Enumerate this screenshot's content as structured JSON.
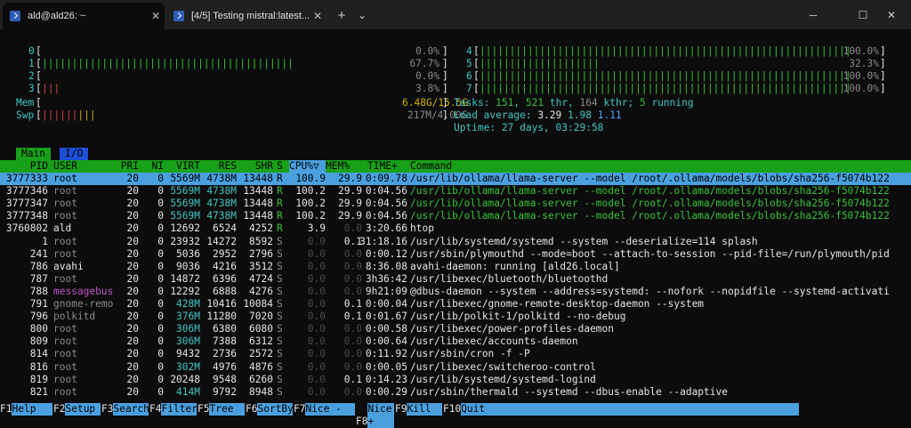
{
  "tabs": [
    {
      "label": "ald@ald26: ~"
    },
    {
      "label": "[4/5] Testing mistral:latest..."
    }
  ],
  "window": {
    "new_tab": "+",
    "dropdown": "⌄",
    "minimize": "─",
    "maximize": "☐",
    "close": "✕"
  },
  "cpu_meters": [
    {
      "label": "0",
      "value": "0.0%",
      "fill": 0.0
    },
    {
      "label": "1",
      "value": "67.7%",
      "fill": 0.677
    },
    {
      "label": "2",
      "value": "0.0%",
      "fill": 0.0
    },
    {
      "label": "3",
      "value": "3.8%",
      "fill": 0.038
    },
    {
      "label": "4",
      "value": "100.0%",
      "fill": 1.0
    },
    {
      "label": "5",
      "value": "32.3%",
      "fill": 0.323
    },
    {
      "label": "6",
      "value": "100.0%",
      "fill": 1.0
    },
    {
      "label": "7",
      "value": "100.0%",
      "fill": 1.0
    }
  ],
  "mem": {
    "label": "Mem",
    "value": "6.48G/15.5G"
  },
  "swp": {
    "label": "Swp",
    "value": "217M/4.00G"
  },
  "tasks": {
    "label": "Tasks:",
    "tasks": "151",
    "thr": "521",
    "thr_label": "thr,",
    "kthr": "164",
    "kthr_label": "kthr;",
    "running": "5",
    "running_label": "running"
  },
  "load": {
    "label": "Load average:",
    "v1": "3.29",
    "v2": "1.98",
    "v3": "1.11"
  },
  "uptime": {
    "label": "Uptime:",
    "value": "27 days, 03:29:58"
  },
  "screen_tabs": [
    "Main",
    "I/O"
  ],
  "columns": [
    "PID",
    "USER",
    "PRI",
    "NI",
    "VIRT",
    "RES",
    "SHR",
    "S",
    "CPU%▽",
    "MEM%",
    "TIME+",
    "Command"
  ],
  "processes": [
    {
      "pid": "3777333",
      "user": "root",
      "pri": "20",
      "ni": "0",
      "virt": "5569M",
      "res": "4738M",
      "shr": "13448",
      "s": "R",
      "cpu": "100.9",
      "mem": "29.9",
      "time": "0:09.78",
      "cmd": "/usr/lib/ollama/llama-server --model /root/.ollama/models/blobs/sha256-f5074b122"
    },
    {
      "pid": "3777346",
      "user": "root",
      "pri": "20",
      "ni": "0",
      "virt": "5569M",
      "res": "4738M",
      "shr": "13448",
      "s": "R",
      "cpu": "100.2",
      "mem": "29.9",
      "time": "0:04.56",
      "cmd": "/usr/lib/ollama/llama-server --model /root/.ollama/models/blobs/sha256-f5074b122"
    },
    {
      "pid": "3777347",
      "user": "root",
      "pri": "20",
      "ni": "0",
      "virt": "5569M",
      "res": "4738M",
      "shr": "13448",
      "s": "R",
      "cpu": "100.2",
      "mem": "29.9",
      "time": "0:04.56",
      "cmd": "/usr/lib/ollama/llama-server --model /root/.ollama/models/blobs/sha256-f5074b122"
    },
    {
      "pid": "3777348",
      "user": "root",
      "pri": "20",
      "ni": "0",
      "virt": "5569M",
      "res": "4738M",
      "shr": "13448",
      "s": "R",
      "cpu": "100.2",
      "mem": "29.9",
      "time": "0:04.56",
      "cmd": "/usr/lib/ollama/llama-server --model /root/.ollama/models/blobs/sha256-f5074b122"
    },
    {
      "pid": "3760802",
      "user": "ald",
      "pri": "20",
      "ni": "0",
      "virt": "12692",
      "res": "6524",
      "shr": "4252",
      "s": "R",
      "cpu": "3.9",
      "mem": "0.0",
      "time": "3:20.66",
      "cmd": "htop"
    },
    {
      "pid": "1",
      "user": "root",
      "pri": "20",
      "ni": "0",
      "virt": "23932",
      "res": "14272",
      "shr": "8592",
      "s": "S",
      "cpu": "0.0",
      "mem": "0.1",
      "time": "31:18.16",
      "cmd": "/usr/lib/systemd/systemd --system --deserialize=114 splash"
    },
    {
      "pid": "241",
      "user": "root",
      "pri": "20",
      "ni": "0",
      "virt": "5036",
      "res": "2952",
      "shr": "2796",
      "s": "S",
      "cpu": "0.0",
      "mem": "0.0",
      "time": "0:00.12",
      "cmd": "/usr/sbin/plymouthd --mode=boot --attach-to-session --pid-file=/run/plymouth/pid"
    },
    {
      "pid": "786",
      "user": "avahi",
      "pri": "20",
      "ni": "0",
      "virt": "9036",
      "res": "4216",
      "shr": "3512",
      "s": "S",
      "cpu": "0.0",
      "mem": "0.0",
      "time": "8:36.08",
      "cmd": "avahi-daemon: running [ald26.local]"
    },
    {
      "pid": "787",
      "user": "root",
      "pri": "20",
      "ni": "0",
      "virt": "14872",
      "res": "6396",
      "shr": "4724",
      "s": "S",
      "cpu": "0.0",
      "mem": "0.0",
      "time": "3h36:42",
      "cmd": "/usr/libexec/bluetooth/bluetoothd"
    },
    {
      "pid": "788",
      "user": "messagebus",
      "pri": "20",
      "ni": "0",
      "virt": "12292",
      "res": "6888",
      "shr": "4276",
      "s": "S",
      "cpu": "0.0",
      "mem": "0.0",
      "time": "9h21:09",
      "cmd": "@dbus-daemon --system --address=systemd: --nofork --nopidfile --systemd-activati"
    },
    {
      "pid": "791",
      "user": "gnome-remo",
      "pri": "20",
      "ni": "0",
      "virt": "428M",
      "res": "10416",
      "shr": "10084",
      "s": "S",
      "cpu": "0.0",
      "mem": "0.1",
      "time": "0:00.04",
      "cmd": "/usr/libexec/gnome-remote-desktop-daemon --system"
    },
    {
      "pid": "796",
      "user": "polkitd",
      "pri": "20",
      "ni": "0",
      "virt": "376M",
      "res": "11280",
      "shr": "7020",
      "s": "S",
      "cpu": "0.0",
      "mem": "0.1",
      "time": "0:01.67",
      "cmd": "/usr/lib/polkit-1/polkitd --no-debug"
    },
    {
      "pid": "800",
      "user": "root",
      "pri": "20",
      "ni": "0",
      "virt": "306M",
      "res": "6380",
      "shr": "6080",
      "s": "S",
      "cpu": "0.0",
      "mem": "0.0",
      "time": "0:00.58",
      "cmd": "/usr/libexec/power-profiles-daemon"
    },
    {
      "pid": "809",
      "user": "root",
      "pri": "20",
      "ni": "0",
      "virt": "306M",
      "res": "7388",
      "shr": "6312",
      "s": "S",
      "cpu": "0.0",
      "mem": "0.0",
      "time": "0:00.64",
      "cmd": "/usr/libexec/accounts-daemon"
    },
    {
      "pid": "814",
      "user": "root",
      "pri": "20",
      "ni": "0",
      "virt": "9432",
      "res": "2736",
      "shr": "2572",
      "s": "S",
      "cpu": "0.0",
      "mem": "0.0",
      "time": "0:11.92",
      "cmd": "/usr/sbin/cron -f -P"
    },
    {
      "pid": "816",
      "user": "root",
      "pri": "20",
      "ni": "0",
      "virt": "302M",
      "res": "4976",
      "shr": "4876",
      "s": "S",
      "cpu": "0.0",
      "mem": "0.0",
      "time": "0:00.05",
      "cmd": "/usr/libexec/switcheroo-control"
    },
    {
      "pid": "819",
      "user": "root",
      "pri": "20",
      "ni": "0",
      "virt": "20248",
      "res": "9548",
      "shr": "6260",
      "s": "S",
      "cpu": "0.0",
      "mem": "0.1",
      "time": "0:14.23",
      "cmd": "/usr/lib/systemd/systemd-logind"
    },
    {
      "pid": "821",
      "user": "root",
      "pri": "20",
      "ni": "0",
      "virt": "414M",
      "res": "9792",
      "shr": "8948",
      "s": "S",
      "cpu": "0.0",
      "mem": "0.0",
      "time": "0:00.29",
      "cmd": "/usr/sbin/thermald --systemd --dbus-enable --adaptive"
    }
  ],
  "fkeys": [
    {
      "key": "F1",
      "label": "Help"
    },
    {
      "key": "F2",
      "label": "Setup"
    },
    {
      "key": "F3",
      "label": "Search"
    },
    {
      "key": "F4",
      "label": "Filter"
    },
    {
      "key": "F5",
      "label": "Tree"
    },
    {
      "key": "F6",
      "label": "SortBy"
    },
    {
      "key": "F7",
      "label": "Nice -"
    },
    {
      "key": "F8",
      "label": "Nice +"
    },
    {
      "key": "F9",
      "label": "Kill"
    },
    {
      "key": "F10",
      "label": "Quit"
    }
  ]
}
